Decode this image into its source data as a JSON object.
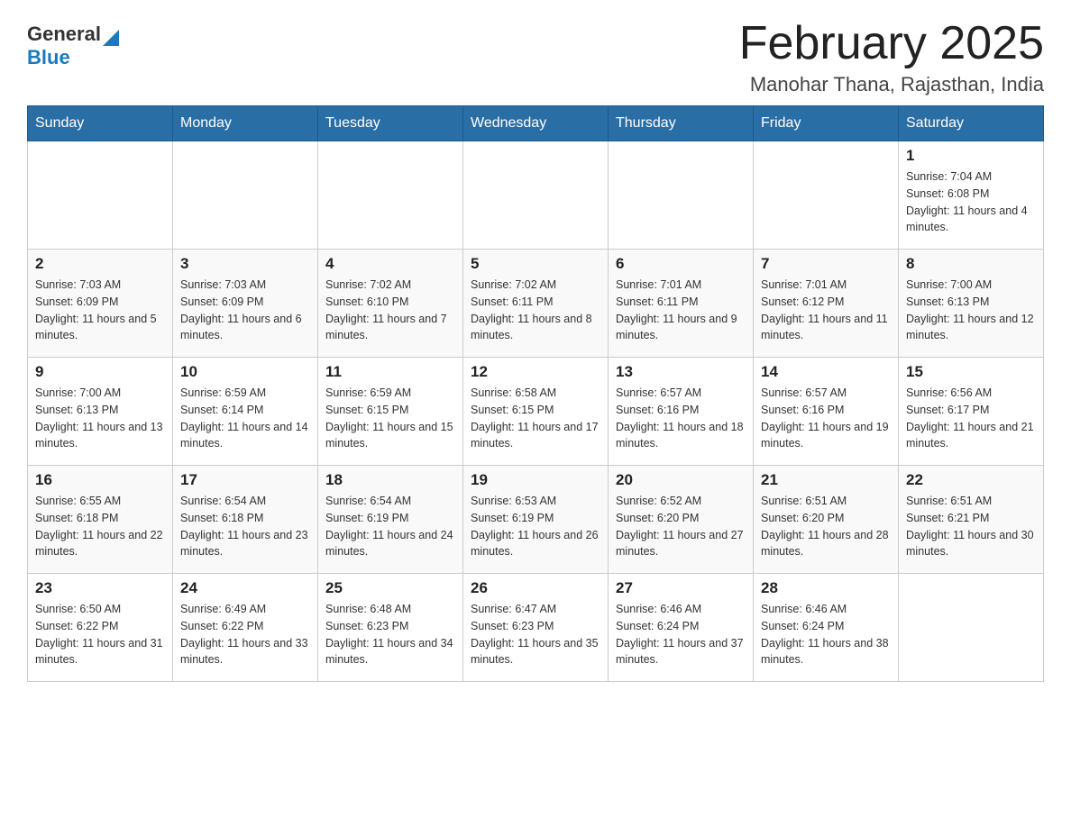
{
  "header": {
    "logo_general": "General",
    "logo_blue": "Blue",
    "month_title": "February 2025",
    "location": "Manohar Thana, Rajasthan, India"
  },
  "weekdays": [
    "Sunday",
    "Monday",
    "Tuesday",
    "Wednesday",
    "Thursday",
    "Friday",
    "Saturday"
  ],
  "weeks": [
    [
      {
        "day": "",
        "sunrise": "",
        "sunset": "",
        "daylight": ""
      },
      {
        "day": "",
        "sunrise": "",
        "sunset": "",
        "daylight": ""
      },
      {
        "day": "",
        "sunrise": "",
        "sunset": "",
        "daylight": ""
      },
      {
        "day": "",
        "sunrise": "",
        "sunset": "",
        "daylight": ""
      },
      {
        "day": "",
        "sunrise": "",
        "sunset": "",
        "daylight": ""
      },
      {
        "day": "",
        "sunrise": "",
        "sunset": "",
        "daylight": ""
      },
      {
        "day": "1",
        "sunrise": "Sunrise: 7:04 AM",
        "sunset": "Sunset: 6:08 PM",
        "daylight": "Daylight: 11 hours and 4 minutes."
      }
    ],
    [
      {
        "day": "2",
        "sunrise": "Sunrise: 7:03 AM",
        "sunset": "Sunset: 6:09 PM",
        "daylight": "Daylight: 11 hours and 5 minutes."
      },
      {
        "day": "3",
        "sunrise": "Sunrise: 7:03 AM",
        "sunset": "Sunset: 6:09 PM",
        "daylight": "Daylight: 11 hours and 6 minutes."
      },
      {
        "day": "4",
        "sunrise": "Sunrise: 7:02 AM",
        "sunset": "Sunset: 6:10 PM",
        "daylight": "Daylight: 11 hours and 7 minutes."
      },
      {
        "day": "5",
        "sunrise": "Sunrise: 7:02 AM",
        "sunset": "Sunset: 6:11 PM",
        "daylight": "Daylight: 11 hours and 8 minutes."
      },
      {
        "day": "6",
        "sunrise": "Sunrise: 7:01 AM",
        "sunset": "Sunset: 6:11 PM",
        "daylight": "Daylight: 11 hours and 9 minutes."
      },
      {
        "day": "7",
        "sunrise": "Sunrise: 7:01 AM",
        "sunset": "Sunset: 6:12 PM",
        "daylight": "Daylight: 11 hours and 11 minutes."
      },
      {
        "day": "8",
        "sunrise": "Sunrise: 7:00 AM",
        "sunset": "Sunset: 6:13 PM",
        "daylight": "Daylight: 11 hours and 12 minutes."
      }
    ],
    [
      {
        "day": "9",
        "sunrise": "Sunrise: 7:00 AM",
        "sunset": "Sunset: 6:13 PM",
        "daylight": "Daylight: 11 hours and 13 minutes."
      },
      {
        "day": "10",
        "sunrise": "Sunrise: 6:59 AM",
        "sunset": "Sunset: 6:14 PM",
        "daylight": "Daylight: 11 hours and 14 minutes."
      },
      {
        "day": "11",
        "sunrise": "Sunrise: 6:59 AM",
        "sunset": "Sunset: 6:15 PM",
        "daylight": "Daylight: 11 hours and 15 minutes."
      },
      {
        "day": "12",
        "sunrise": "Sunrise: 6:58 AM",
        "sunset": "Sunset: 6:15 PM",
        "daylight": "Daylight: 11 hours and 17 minutes."
      },
      {
        "day": "13",
        "sunrise": "Sunrise: 6:57 AM",
        "sunset": "Sunset: 6:16 PM",
        "daylight": "Daylight: 11 hours and 18 minutes."
      },
      {
        "day": "14",
        "sunrise": "Sunrise: 6:57 AM",
        "sunset": "Sunset: 6:16 PM",
        "daylight": "Daylight: 11 hours and 19 minutes."
      },
      {
        "day": "15",
        "sunrise": "Sunrise: 6:56 AM",
        "sunset": "Sunset: 6:17 PM",
        "daylight": "Daylight: 11 hours and 21 minutes."
      }
    ],
    [
      {
        "day": "16",
        "sunrise": "Sunrise: 6:55 AM",
        "sunset": "Sunset: 6:18 PM",
        "daylight": "Daylight: 11 hours and 22 minutes."
      },
      {
        "day": "17",
        "sunrise": "Sunrise: 6:54 AM",
        "sunset": "Sunset: 6:18 PM",
        "daylight": "Daylight: 11 hours and 23 minutes."
      },
      {
        "day": "18",
        "sunrise": "Sunrise: 6:54 AM",
        "sunset": "Sunset: 6:19 PM",
        "daylight": "Daylight: 11 hours and 24 minutes."
      },
      {
        "day": "19",
        "sunrise": "Sunrise: 6:53 AM",
        "sunset": "Sunset: 6:19 PM",
        "daylight": "Daylight: 11 hours and 26 minutes."
      },
      {
        "day": "20",
        "sunrise": "Sunrise: 6:52 AM",
        "sunset": "Sunset: 6:20 PM",
        "daylight": "Daylight: 11 hours and 27 minutes."
      },
      {
        "day": "21",
        "sunrise": "Sunrise: 6:51 AM",
        "sunset": "Sunset: 6:20 PM",
        "daylight": "Daylight: 11 hours and 28 minutes."
      },
      {
        "day": "22",
        "sunrise": "Sunrise: 6:51 AM",
        "sunset": "Sunset: 6:21 PM",
        "daylight": "Daylight: 11 hours and 30 minutes."
      }
    ],
    [
      {
        "day": "23",
        "sunrise": "Sunrise: 6:50 AM",
        "sunset": "Sunset: 6:22 PM",
        "daylight": "Daylight: 11 hours and 31 minutes."
      },
      {
        "day": "24",
        "sunrise": "Sunrise: 6:49 AM",
        "sunset": "Sunset: 6:22 PM",
        "daylight": "Daylight: 11 hours and 33 minutes."
      },
      {
        "day": "25",
        "sunrise": "Sunrise: 6:48 AM",
        "sunset": "Sunset: 6:23 PM",
        "daylight": "Daylight: 11 hours and 34 minutes."
      },
      {
        "day": "26",
        "sunrise": "Sunrise: 6:47 AM",
        "sunset": "Sunset: 6:23 PM",
        "daylight": "Daylight: 11 hours and 35 minutes."
      },
      {
        "day": "27",
        "sunrise": "Sunrise: 6:46 AM",
        "sunset": "Sunset: 6:24 PM",
        "daylight": "Daylight: 11 hours and 37 minutes."
      },
      {
        "day": "28",
        "sunrise": "Sunrise: 6:46 AM",
        "sunset": "Sunset: 6:24 PM",
        "daylight": "Daylight: 11 hours and 38 minutes."
      },
      {
        "day": "",
        "sunrise": "",
        "sunset": "",
        "daylight": ""
      }
    ]
  ]
}
